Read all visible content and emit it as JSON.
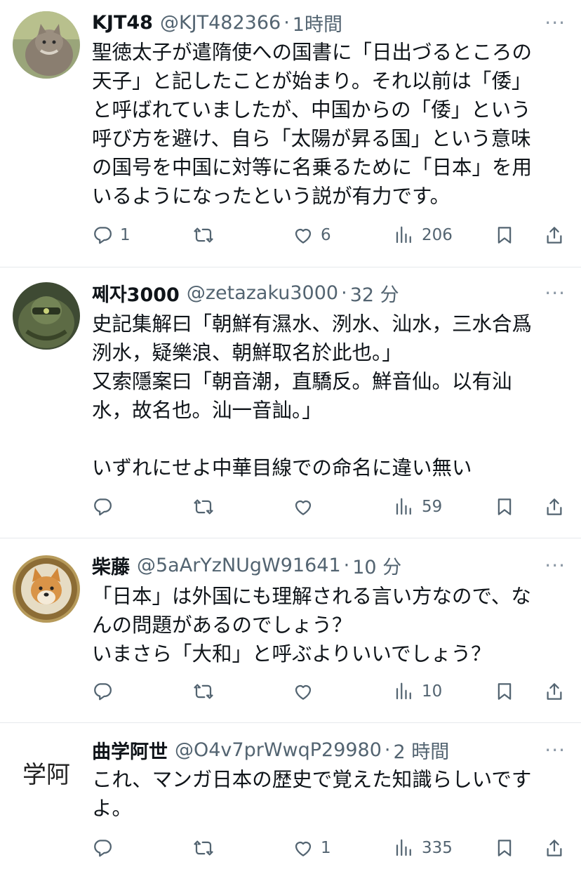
{
  "colors": {
    "text": "#0f1419",
    "secondary": "#536471",
    "divider": "#e6e9ec",
    "icon": "#536471"
  },
  "tweets": [
    {
      "name": "KJT48",
      "handle": "@KJT482366",
      "separator": "·",
      "time": "1時間",
      "more": "···",
      "avatar_icon": "cat-avatar",
      "text": "聖徳太子が遣隋使への国書に「日出づるところの\n天子」と記したことが始まり。それ以前は「倭」\nと呼ばれていましたが、中国からの「倭」という\n呼び方を避け、自ら「太陽が昇る国」という意味\nの国号を中国に対等に名乗るために「日本」を用\nいるようになったという説が有力です。",
      "replies": "1",
      "reposts": "",
      "likes": "6",
      "views": "206"
    },
    {
      "name": "쩨자3000",
      "handle": "@zetazaku3000",
      "separator": "·",
      "time": "32 分",
      "more": "···",
      "avatar_icon": "robot-avatar",
      "text": "史記集解曰「朝鮮有濕水、洌水、汕水，三水合爲\n洌水，疑樂浪、朝鮮取名於此也。」\n又索隱案曰「朝音潮，直驕反。鮮音仙。以有汕\n水，故名也。汕一音訕。」\n\nいずれにせよ中華目線での命名に違い無い",
      "replies": "",
      "reposts": "",
      "likes": "",
      "views": "59"
    },
    {
      "name": "柴藤",
      "handle": "@5aArYzNUgW91641",
      "separator": "·",
      "time": "10 分",
      "more": "···",
      "avatar_icon": "shiba-dog-avatar",
      "text": "「日本」は外国にも理解される言い方なので、な\nんの問題があるのでしょう？\nいまさら「大和」と呼ぶよりいいでしょう？",
      "replies": "",
      "reposts": "",
      "likes": "",
      "views": "10"
    },
    {
      "name": "曲学阿世",
      "handle": "@O4v7prWwqP29980",
      "separator": "·",
      "time": "2 時間",
      "more": "···",
      "avatar_icon": "calligraphy-avatar",
      "avatar_text": "学阿",
      "text": "これ、マンガ日本の歴史で覚えた知識らしいです\nよ。",
      "replies": "",
      "reposts": "",
      "likes": "1",
      "views": "335"
    }
  ]
}
